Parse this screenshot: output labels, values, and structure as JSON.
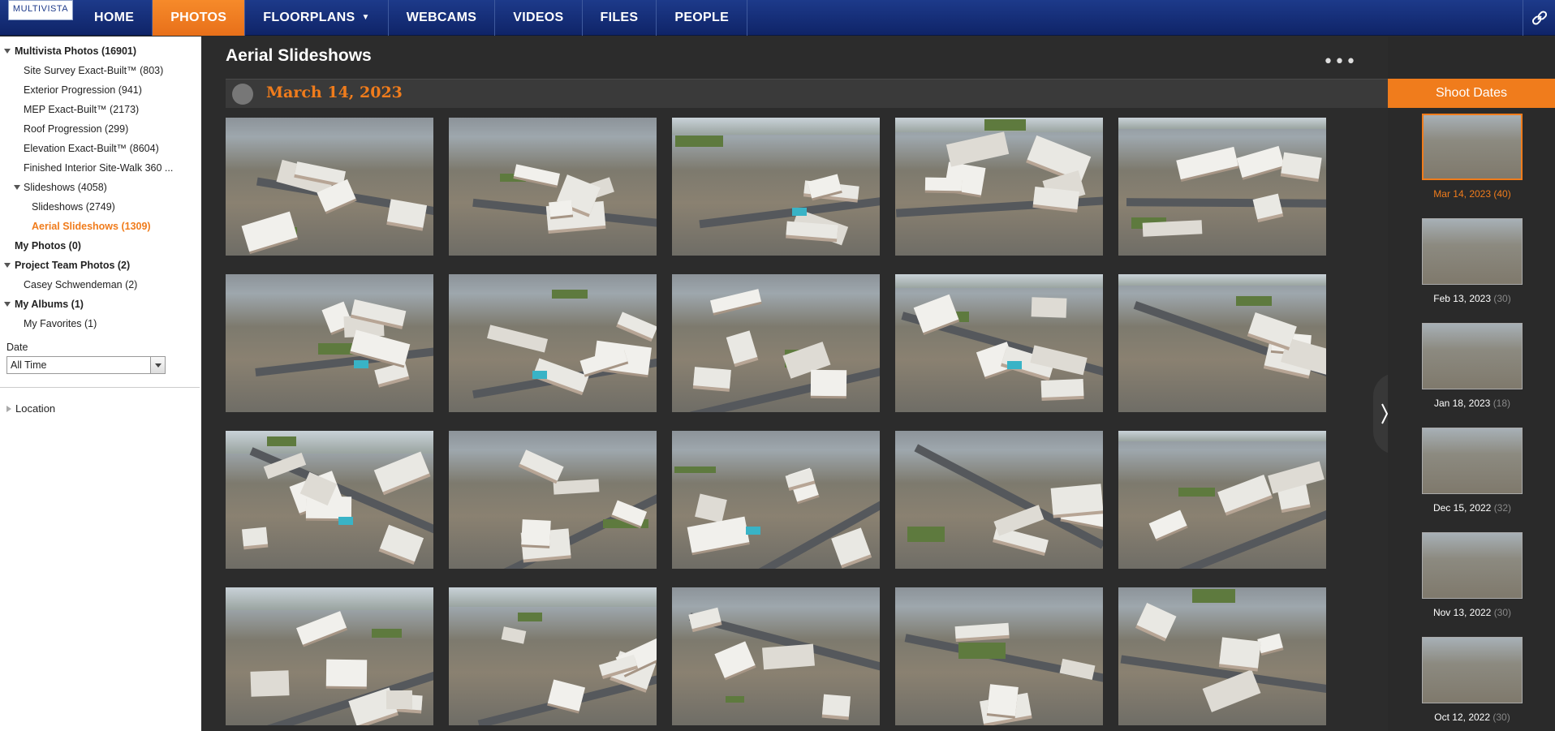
{
  "brand": {
    "logo_text": "MULTIVISTA"
  },
  "nav": {
    "items": [
      {
        "label": "HOME",
        "active": false
      },
      {
        "label": "PHOTOS",
        "active": true
      },
      {
        "label": "FLOORPLANS",
        "active": false,
        "has_dropdown": true
      },
      {
        "label": "WEBCAMS",
        "active": false
      },
      {
        "label": "VIDEOS",
        "active": false
      },
      {
        "label": "FILES",
        "active": false
      },
      {
        "label": "PEOPLE",
        "active": false
      }
    ],
    "link_icon": "link-icon"
  },
  "sidebar": {
    "tree": [
      {
        "label": "Multivista Photos (16901)",
        "level": 0,
        "bold": true,
        "expanded": true
      },
      {
        "label": "Site Survey Exact-Built™ (803)",
        "level": 1
      },
      {
        "label": "Exterior Progression (941)",
        "level": 1
      },
      {
        "label": "MEP Exact-Built™ (2173)",
        "level": 1
      },
      {
        "label": "Roof Progression (299)",
        "level": 1
      },
      {
        "label": "Elevation Exact-Built™ (8604)",
        "level": 1
      },
      {
        "label": "Finished Interior Site-Walk 360 ...",
        "level": 1
      },
      {
        "label": "Slideshows (4058)",
        "level": 1,
        "expanded": true
      },
      {
        "label": "Slideshows (2749)",
        "level": 2
      },
      {
        "label": "Aerial Slideshows (1309)",
        "level": 2,
        "selected": true
      },
      {
        "label": "My Photos (0)",
        "level": 0,
        "bold": true
      },
      {
        "label": "Project Team Photos (2)",
        "level": 0,
        "bold": true,
        "expanded": true
      },
      {
        "label": "Casey Schwendeman (2)",
        "level": 1
      },
      {
        "label": "My Albums (1)",
        "level": 0,
        "bold": true,
        "expanded": true
      },
      {
        "label": "My Favorites (1)",
        "level": 1
      }
    ],
    "date_filter": {
      "label": "Date",
      "value": "All Time"
    },
    "location": {
      "label": "Location"
    }
  },
  "main": {
    "title": "Aerial Slideshows",
    "more_label": "•••",
    "group_date": "March 14, 2023",
    "photo_rows": 4,
    "photo_cols": 5
  },
  "shoot_dates": {
    "title": "Shoot Dates",
    "items": [
      {
        "date": "Mar 14, 2023",
        "count": "(40)",
        "selected": true
      },
      {
        "date": "Feb 13, 2023",
        "count": "(30)",
        "selected": false
      },
      {
        "date": "Jan 18, 2023",
        "count": "(18)",
        "selected": false
      },
      {
        "date": "Dec 15, 2022",
        "count": "(32)",
        "selected": false
      },
      {
        "date": "Nov 13, 2022",
        "count": "(30)",
        "selected": false
      },
      {
        "date": "Oct 12, 2022",
        "count": "(30)",
        "selected": false
      }
    ]
  },
  "colors": {
    "accent": "#f07c1c",
    "nav_bg": "#1d3a8a",
    "main_bg": "#2c2c2c"
  }
}
